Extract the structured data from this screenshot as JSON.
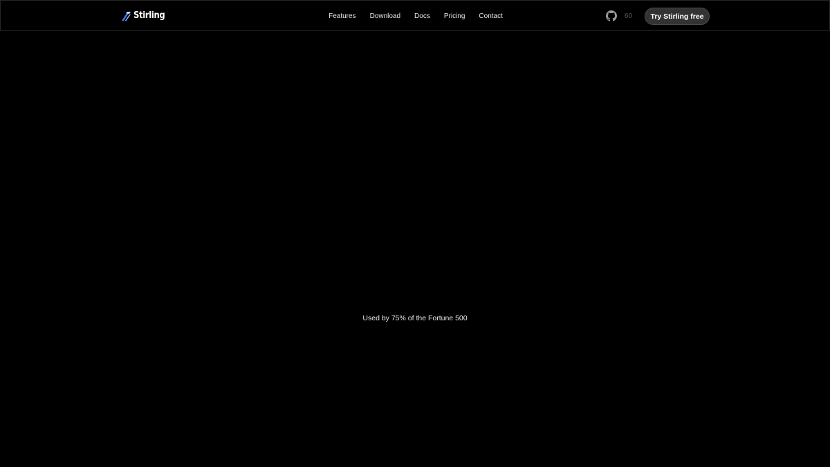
{
  "brand": {
    "name": "Stirling",
    "logo_icon": "stirling-logo-icon",
    "accent_color": "#4a90e2"
  },
  "nav": {
    "links": [
      {
        "label": "Features"
      },
      {
        "label": "Download"
      },
      {
        "label": "Docs"
      },
      {
        "label": "Pricing"
      },
      {
        "label": "Contact"
      }
    ]
  },
  "github": {
    "icon": "github-icon",
    "stars": "60"
  },
  "cta": {
    "label": "Try Stirling free"
  },
  "hero": {
    "tagline": "Used by 75% of the Fortune 500"
  },
  "colors": {
    "background": "#000000",
    "cta_background": "#333333",
    "nav_border": "#262626"
  }
}
